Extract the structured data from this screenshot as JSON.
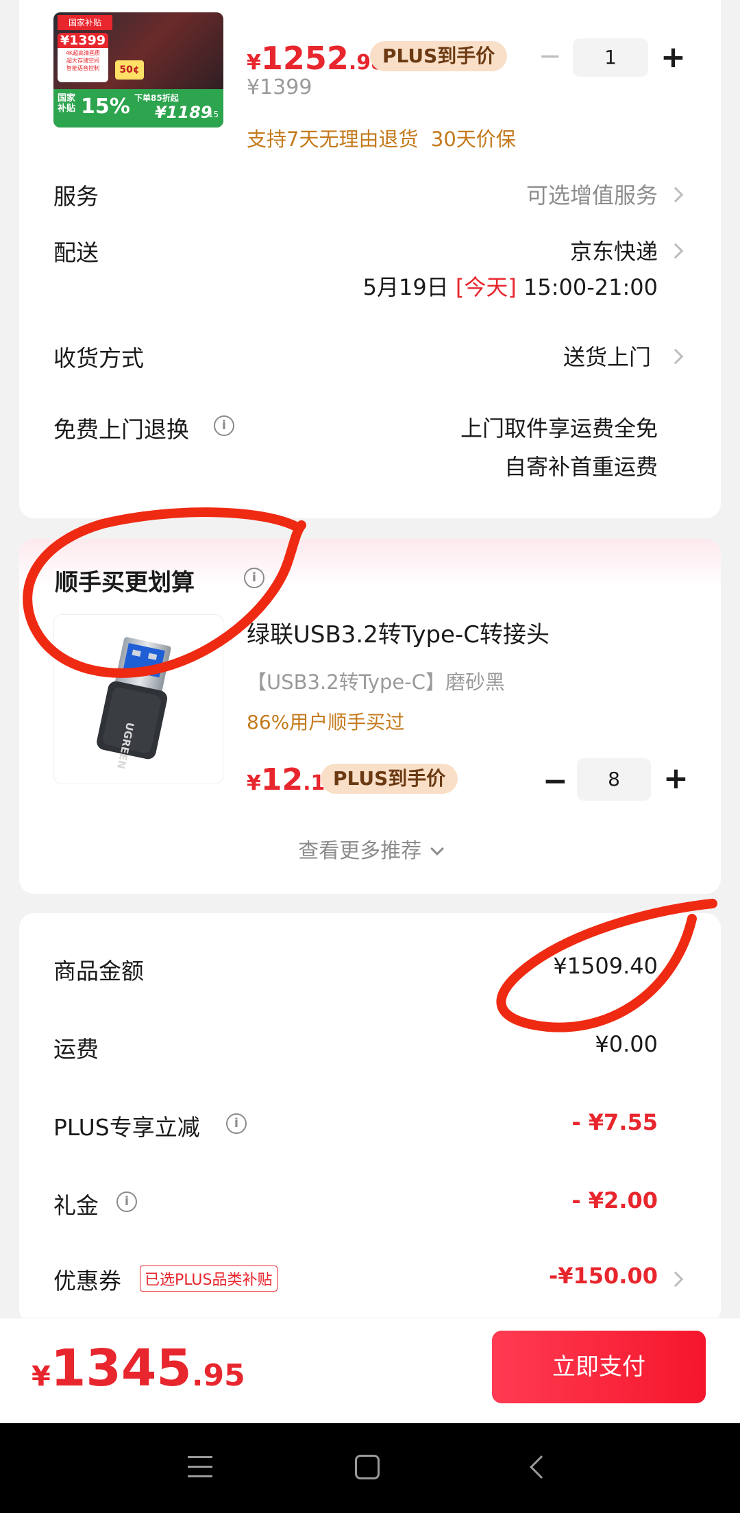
{
  "product1": {
    "thumb": {
      "tag_top": "国家补贴",
      "price_badge": "¥1399",
      "line1": "4K超高清画质",
      "line2": "超大存储空间",
      "line3": "智能语音控制",
      "bubble": "50¢",
      "subsidy_label": "国家补贴",
      "subsidy_pct": "15%",
      "subsidy_sub": "下单85折起",
      "final_price": "¥1189",
      "final_cents": ".15"
    },
    "price_currency": "¥",
    "price_int": "1252",
    "price_dec": ".98",
    "plus_tag": "PLUS到手价",
    "qty_minus": "−",
    "qty": "1",
    "qty_plus": "+",
    "original_price": "¥1399",
    "promise": "支持7天无理由退货  30天价保"
  },
  "service": {
    "label": "服务",
    "value": "可选增值服务"
  },
  "delivery": {
    "label": "配送",
    "carrier": "京东快递",
    "date": "5月19日",
    "today": "[今天]",
    "time": "15:00-21:00"
  },
  "receive": {
    "label": "收货方式",
    "value": "送货上门"
  },
  "free_return": {
    "label": "免费上门退换",
    "info_icon": "i",
    "line1": "上门取件享运费全免",
    "line2": "自寄补首重运费"
  },
  "addon": {
    "title": "顺手买更划算",
    "info_icon": "i",
    "product_name": "绿联USB3.2转Type-C转接头",
    "spec": "【USB3.2转Type-C】磨砂黑",
    "social": "86%用户顺手买过",
    "thumb_brand": "UGREEN",
    "price_currency": "¥",
    "price_int": "12",
    "price_dec": ".1",
    "plus_tag": "PLUS到手价",
    "qty_minus": "−",
    "qty": "8",
    "qty_plus": "+",
    "more": "查看更多推荐"
  },
  "summary": {
    "goods_label": "商品金额",
    "goods_value": "¥1509.40",
    "shipping_label": "运费",
    "shipping_value": "¥0.00",
    "plus_label": "PLUS专享立减",
    "plus_value": "- ¥7.55",
    "gift_label": "礼金",
    "gift_value": "- ¥2.00",
    "coupon_label": "优惠券",
    "coupon_tag": "已选PLUS品类补贴",
    "coupon_value": "-¥150.00"
  },
  "footer": {
    "currency": "¥",
    "total_int": "1345",
    "total_dec": ".95",
    "pay_button": "立即支付"
  },
  "colors": {
    "accent_red": "#e8262d",
    "plus_tag_bg": "#f9dfc8",
    "promise_gold": "#c47a1c",
    "annotation_red": "#ef2a12"
  }
}
